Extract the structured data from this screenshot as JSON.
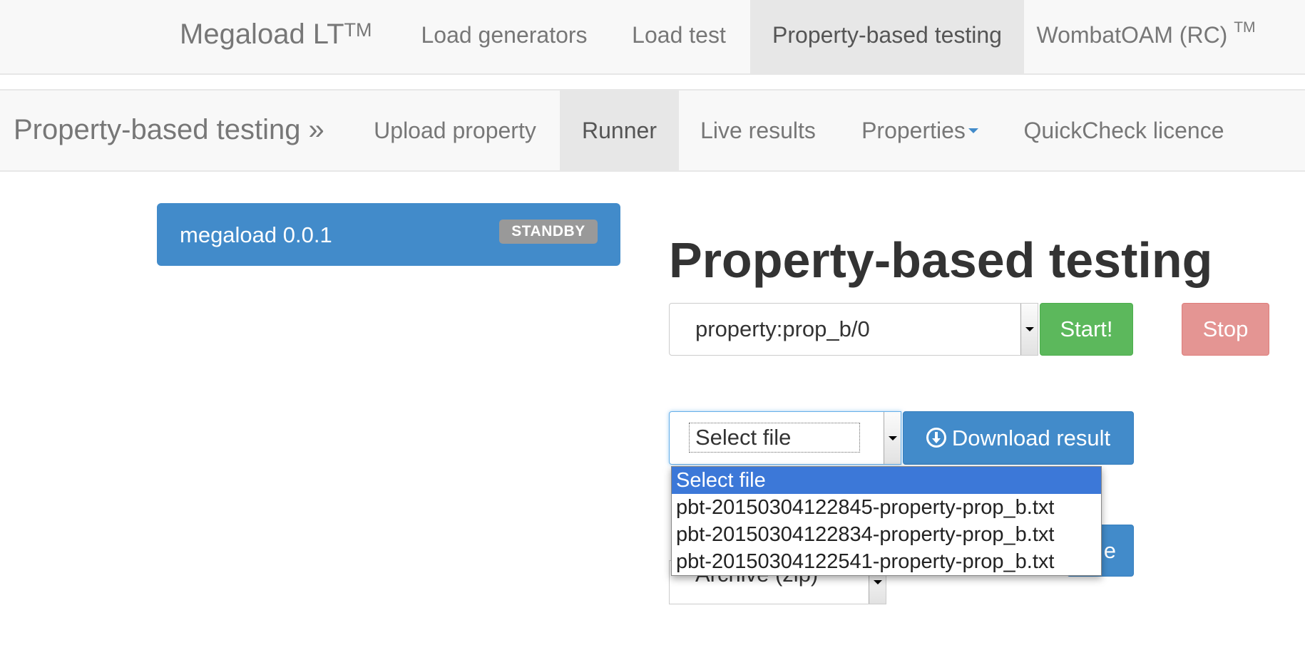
{
  "topnav": {
    "brand": "Megaload LT",
    "brand_sup": "TM",
    "items": [
      {
        "label": "Load generators"
      },
      {
        "label": "Load test"
      },
      {
        "label": "Property-based testing",
        "active": true
      },
      {
        "label": "WombatOAM (RC)",
        "sup": "TM"
      }
    ]
  },
  "subnav": {
    "brand": "Property-based testing »",
    "items": [
      {
        "label": "Upload property"
      },
      {
        "label": "Runner",
        "active": true
      },
      {
        "label": "Live results"
      },
      {
        "label": "Properties",
        "dropdown": true
      },
      {
        "label": "QuickCheck licence"
      }
    ]
  },
  "node": {
    "name": "megaload 0.0.1",
    "status": "STANDBY"
  },
  "main": {
    "heading": "Property-based testing",
    "property_select": {
      "value": "property:prop_b/0"
    },
    "start_label": "Start!",
    "stop_label": "Stop",
    "file_select": {
      "value": "Select file"
    },
    "download_label": "Download result",
    "download_icon": "circle-arrow-down-icon",
    "archive_select": {
      "value": "Archive (zip)"
    },
    "hidden_button_label": "e"
  },
  "dropdown": {
    "options": [
      {
        "label": "Select file",
        "selected": true
      },
      {
        "label": "pbt-20150304122845-property-prop_b.txt"
      },
      {
        "label": "pbt-20150304122834-property-prop_b.txt"
      },
      {
        "label": "pbt-20150304122541-property-prop_b.txt"
      }
    ]
  },
  "colors": {
    "primary": "#428bca",
    "success": "#5cb85c",
    "danger": "#e49593",
    "badge": "#999999",
    "dropdown_highlight": "#3c78d8"
  }
}
